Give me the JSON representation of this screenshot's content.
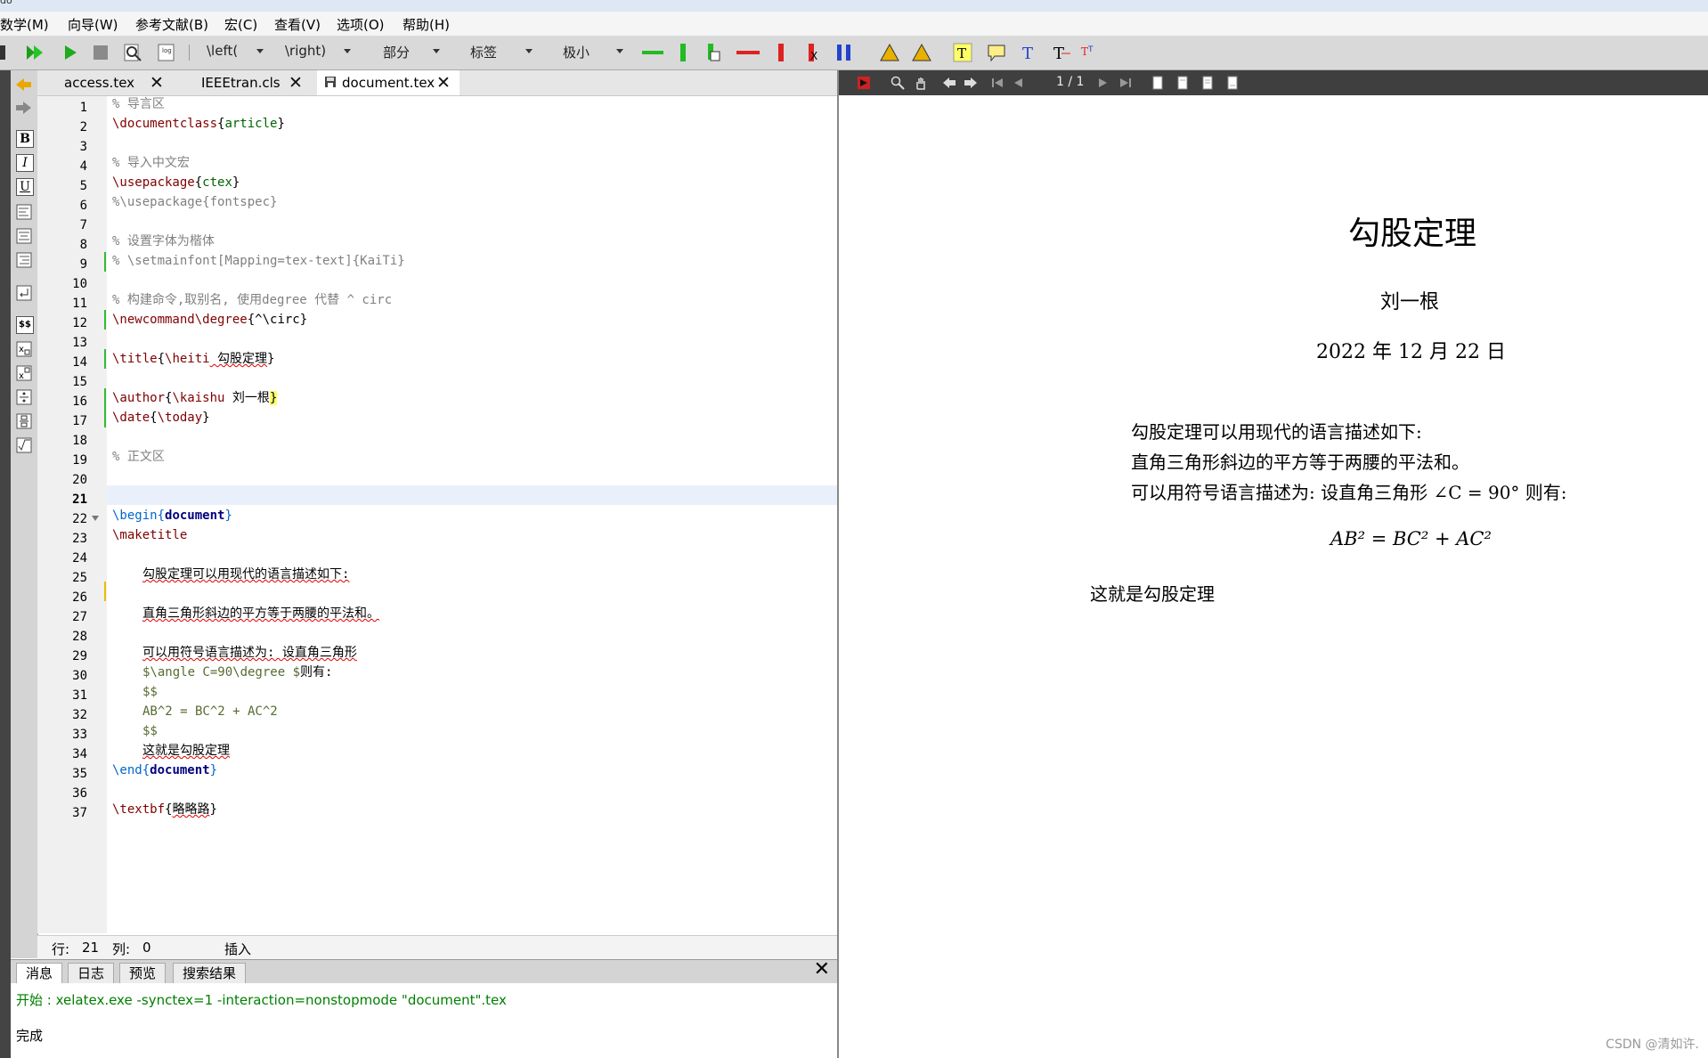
{
  "title_strip": "do",
  "menu": [
    "数学(M)",
    "向导(W)",
    "参考文献(B)",
    "宏(C)",
    "查看(V)",
    "选项(O)",
    "帮助(H)"
  ],
  "toolbar": {
    "combos": [
      "\\left(",
      "\\right)",
      "部分",
      "标签",
      "极小"
    ]
  },
  "tabs": [
    {
      "label": "access.tex"
    },
    {
      "label": "IEEEtran.cls"
    },
    {
      "label": "document.tex"
    }
  ],
  "editor": {
    "line_numbers": [
      "1",
      "2",
      "3",
      "4",
      "5",
      "6",
      "7",
      "8",
      "9",
      "10",
      "11",
      "12",
      "13",
      "14",
      "15",
      "16",
      "17",
      "18",
      "19",
      "20",
      "21",
      "22",
      "23",
      "24",
      "25",
      "26",
      "27",
      "28",
      "29",
      "30",
      "31",
      "32",
      "33",
      "34",
      "35",
      "36",
      "37"
    ],
    "lines": {
      "l1": "% 导言区",
      "l2_cmd": "\\documentclass",
      "l2_arg": "article",
      "l4": "% 导入中文宏",
      "l5_cmd": "\\usepackage",
      "l5_arg": "ctex",
      "l6": "%\\usepackage{fontspec}",
      "l8": "% 设置字体为楷体",
      "l9": "% \\setmainfont[Mapping=tex-text]{KaiTi}",
      "l11": "% 构建命令,取别名, 使用degree 代替 ^ circ",
      "l12_cmd": "\\newcommand\\degree",
      "l12_arg": "^\\circ",
      "l14_cmd": "\\title",
      "l14_cmd2": "\\heiti",
      "l14_text": " 勾股定理",
      "l16_cmd": "\\author",
      "l16_cmd2": "\\kaishu",
      "l16_text": " 刘一根",
      "l17_cmd": "\\date",
      "l17_cmd2": "\\today",
      "l19": "% 正文区",
      "l22_cmd": "\\begin",
      "l22_arg": "document",
      "l23": "\\maketitle",
      "l25": "勾股定理可以用现代的语言描述如下:",
      "l27": "直角三角形斜边的平方等于两腰的平法和。",
      "l29": "可以用符号语言描述为: 设直角三角形",
      "l30_math": "$\\angle C=90\\degree $",
      "l30_text": "则有:",
      "l31": "$$",
      "l32": "AB^2 = BC^2 + AC^2",
      "l33": "$$",
      "l34": "这就是勾股定理",
      "l35_cmd": "\\end",
      "l35_arg": "document",
      "l37_cmd": "\\textbf",
      "l37_arg": "略略路"
    }
  },
  "status": {
    "row_label": "行:",
    "row_value": "21",
    "col_label": "列:",
    "col_value": "0",
    "mode": "插入"
  },
  "bottom_tabs": [
    "消息",
    "日志",
    "预览",
    "搜索结果"
  ],
  "messages": {
    "start": "开始 : xelatex.exe -synctex=1 -interaction=nonstopmode \"document\".tex",
    "done": "完成"
  },
  "pdf": {
    "page_indicator": "1 / 1",
    "title": "勾股定理",
    "author": "刘一根",
    "date": "2022 年 12 月 22 日",
    "para1": "勾股定理可以用现代的语言描述如下:",
    "para2": "直角三角形斜边的平方等于两腰的平法和。",
    "para3": "可以用符号语言描述为: 设直角三角形 ∠C = 90° 则有:",
    "equation": "AB² = BC² + AC²",
    "para4": "这就是勾股定理"
  },
  "watermark": "CSDN @清如许."
}
